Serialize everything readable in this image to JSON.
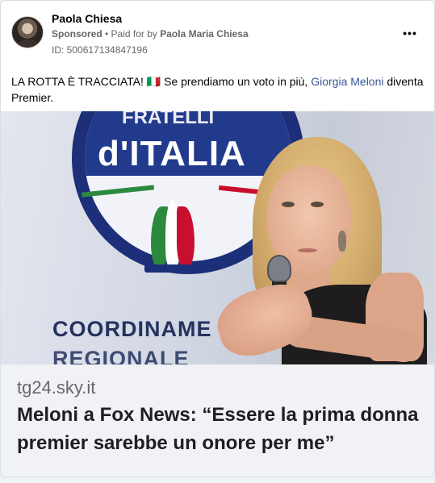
{
  "post": {
    "page_name": "Paola Chiesa",
    "sponsored_label": "Sponsored",
    "paid_for_prefix": " • Paid for by ",
    "payer": "Paola Maria Chiesa",
    "ad_id": "ID: 500617134847196",
    "more_icon": "more-options-icon",
    "text_before": "LA ROTTA È TRACCIATA! 🇮🇹 Se prendiamo un voto in più, ",
    "text_mention": "Giorgia Meloni",
    "text_after": " diventa Premier."
  },
  "image": {
    "logo_top": "FRATELLI",
    "logo_word": "d'ITALIA",
    "banner_line1": "COORDINAME",
    "banner_line2": "REGIONALE"
  },
  "link_preview": {
    "domain": "tg24.sky.it",
    "title": "Meloni a Fox News: “Essere la prima donna premier sarebbe un onore per me”"
  },
  "colors": {
    "mention": "#385898",
    "secondary_text": "#65676b",
    "preview_bg": "#f0f2f5",
    "logo_blue": "#1c2f78"
  }
}
